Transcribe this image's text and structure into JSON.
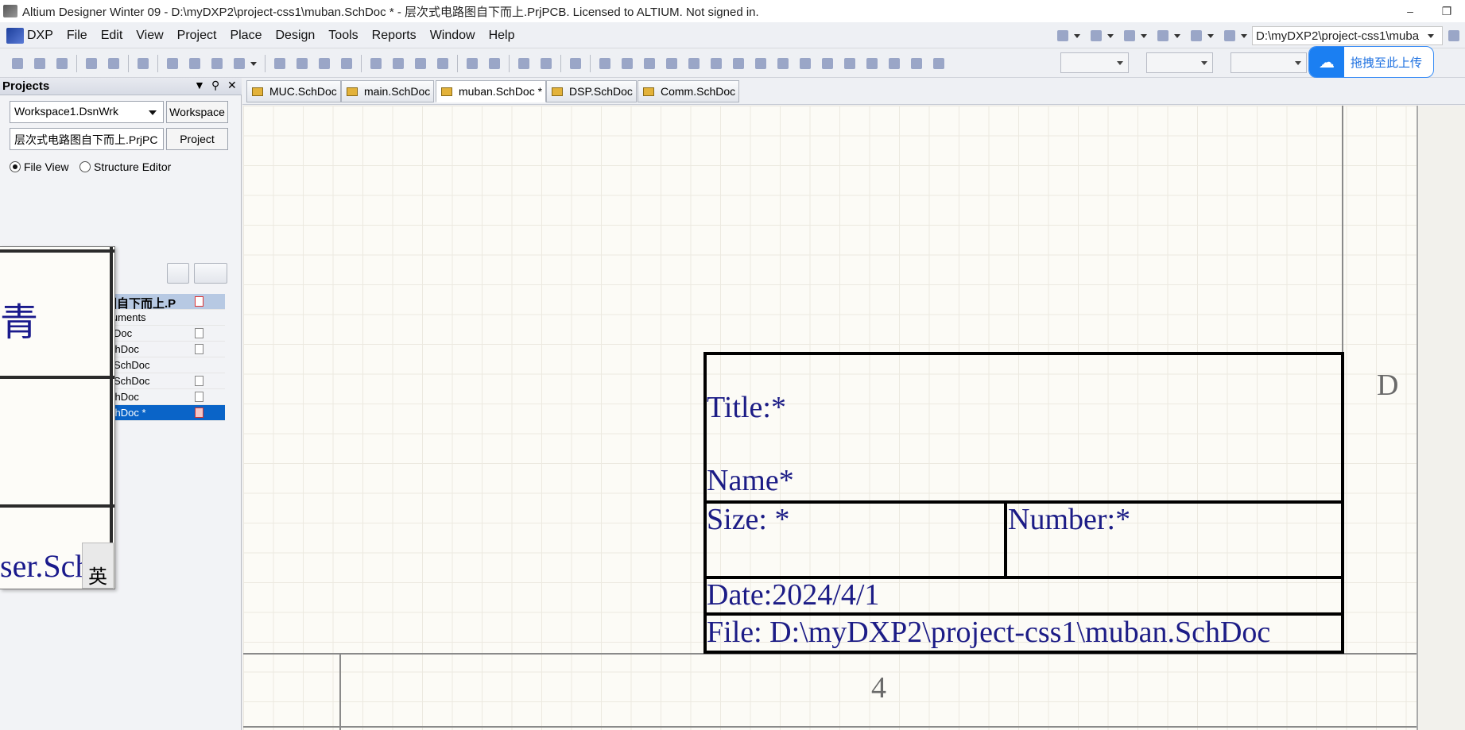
{
  "window": {
    "title": "Altium Designer Winter 09 - D:\\myDXP2\\project-css1\\muban.SchDoc * - 层次式电路图自下而上.PrjPCB. Licensed to ALTIUM. Not signed in.",
    "minimize": "–",
    "restore": "❐"
  },
  "menu": {
    "items": [
      "DXP",
      "File",
      "Edit",
      "View",
      "Project",
      "Place",
      "Design",
      "Tools",
      "Reports",
      "Window",
      "Help"
    ],
    "path_combo": "D:\\myDXP2\\project-css1\\muba"
  },
  "upload_button": {
    "label": "拖拽至此上传"
  },
  "projects_panel": {
    "title": "Projects",
    "workspace_value": "Workspace1.DsnWrk",
    "workspace_button": "Workspace",
    "project_value": "层次式电路图自下而上.PrjPC",
    "project_button": "Project",
    "radio_file_view": "File View",
    "radio_structure_editor": "Structure Editor",
    "tree": {
      "root": "层次式电路图自下而上.P",
      "source_folder": "Source Documents",
      "rows": [
        "Doc",
        "chDoc",
        "SchDoc",
        "SchDoc",
        "chDoc",
        "chDoc *"
      ]
    }
  },
  "popup": {
    "glyph": "青",
    "bottom_text": "ser.Sch",
    "ime": "英"
  },
  "tabs": [
    {
      "label": "MUC.SchDoc"
    },
    {
      "label": "main.SchDoc"
    },
    {
      "label": "muban.SchDoc *"
    },
    {
      "label": "DSP.SchDoc"
    },
    {
      "label": "Comm.SchDoc"
    }
  ],
  "sheet": {
    "zone_row": "D",
    "zone_col": "4",
    "title_block": {
      "title": "Title:*",
      "name": "Name*",
      "size": "Size: *",
      "number": "Number:*",
      "date": "Date:2024/4/1",
      "file": "File: D:\\myDXP2\\project-css1\\muban.SchDoc"
    }
  },
  "colors": {
    "schematic_text": "#1c1c86",
    "selection": "#0a64c8",
    "upload_accent": "#1b7ff2"
  }
}
